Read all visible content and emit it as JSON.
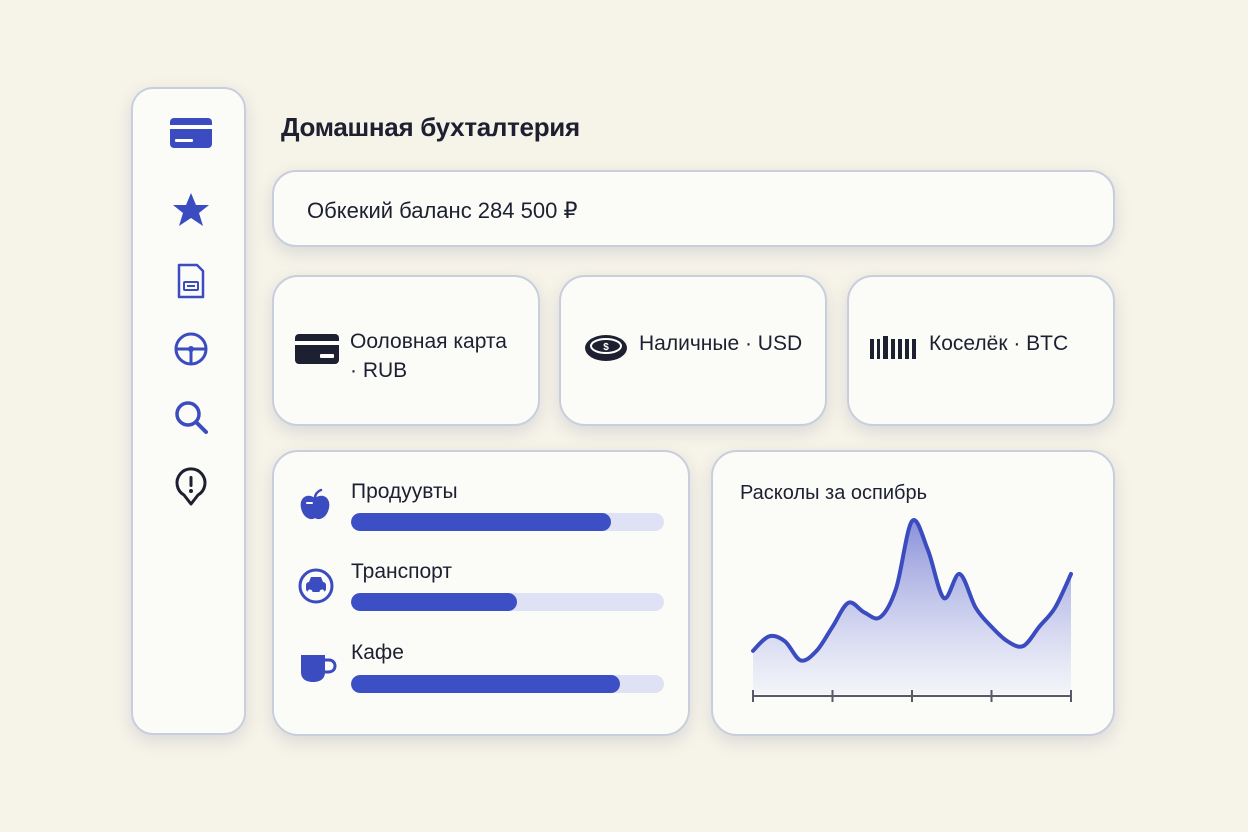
{
  "app": {
    "title": "Домашная бухталтерия"
  },
  "sidebar": {
    "items": [
      {
        "icon": "credit-card-icon"
      },
      {
        "icon": "star-icon"
      },
      {
        "icon": "document-icon"
      },
      {
        "icon": "steering-wheel-icon"
      },
      {
        "icon": "search-icon"
      },
      {
        "icon": "alert-pin-icon"
      }
    ]
  },
  "balance": {
    "text": "Обкекий баланс 284 500 ₽"
  },
  "accounts": [
    {
      "line1": "Ооловная карта",
      "line2": "· RUB",
      "icon": "card-icon"
    },
    {
      "line1": "Наличные · USD",
      "icon": "cash-icon"
    },
    {
      "line1": "Коселёк · BTC",
      "icon": "barcode-icon"
    }
  ],
  "budgets": [
    {
      "label": "Продуувты",
      "progress": 0.83,
      "icon": "apple-icon"
    },
    {
      "label": "Транспорт",
      "progress": 0.53,
      "icon": "car-icon"
    },
    {
      "label": "Кафе",
      "progress": 0.86,
      "icon": "cup-icon"
    }
  ],
  "chart_data": {
    "type": "area",
    "title": "Расколы за оспибрь",
    "x": [
      0,
      1,
      2,
      3,
      4,
      5,
      6,
      7,
      8,
      9,
      10,
      11,
      12,
      13,
      14,
      15,
      16,
      17,
      18,
      19,
      20
    ],
    "values": [
      9,
      12,
      11,
      7,
      9,
      14,
      19,
      17,
      16,
      22,
      36,
      30,
      20,
      25,
      18,
      14,
      11,
      10,
      14,
      18,
      25
    ],
    "xlim": [
      0,
      20
    ],
    "ylim": [
      0,
      40
    ],
    "ticks": 5,
    "colors": {
      "line": "#3b4bc0",
      "fill_top": "#7d85d6",
      "fill_bottom": "#eef0fa"
    }
  },
  "colors": {
    "accent": "#3c4fc4",
    "track": "#dfe2f5",
    "background": "#f6f3e8"
  }
}
